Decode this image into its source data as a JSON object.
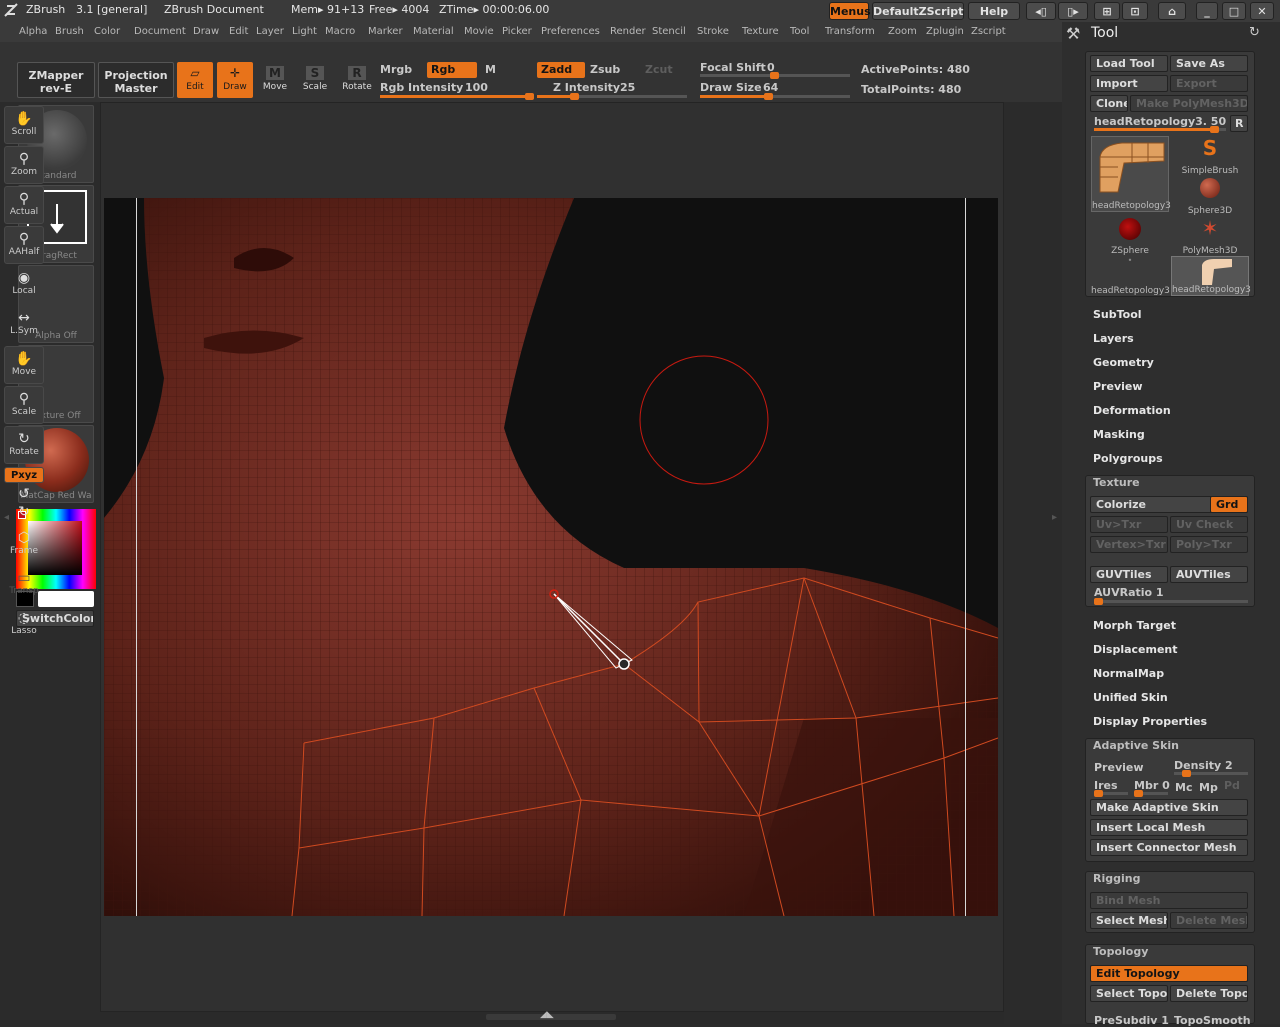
{
  "titlebar": {
    "app": "ZBrush",
    "version": "3.1 [general]",
    "document": "ZBrush Document",
    "mem": "Mem▸ 91+13",
    "free": "Free▸ 4004",
    "ztime": "ZTime▸ 00:00:06.00",
    "menus_btn": "Menus",
    "script_btn": "DefaultZScript",
    "help_btn": "Help"
  },
  "menubar": [
    "Alpha",
    "Brush",
    "Color",
    "Document",
    "Draw",
    "Edit",
    "Layer",
    "Light",
    "Macro",
    "Marker",
    "Material",
    "Movie",
    "Picker",
    "Preferences",
    "Render",
    "Stencil",
    "Stroke",
    "Texture",
    "Tool",
    "Transform",
    "Zoom",
    "Zplugin",
    "Zscript"
  ],
  "toolbar": {
    "zmapper_line1": "ZMapper",
    "zmapper_line2": "rev-E",
    "projection_line1": "Projection",
    "projection_line2": "Master",
    "modes": [
      {
        "label": "Edit",
        "icon": "edit-icon"
      },
      {
        "label": "Draw",
        "icon": "draw-icon"
      },
      {
        "label": "Move",
        "icon": "move-icon"
      },
      {
        "label": "Scale",
        "icon": "scale-icon"
      },
      {
        "label": "Rotate",
        "icon": "rotate-icon"
      }
    ],
    "mrgb": "Mrgb",
    "rgb": "Rgb",
    "m": "M",
    "rgb_intensity_label": "Rgb  Intensity",
    "rgb_intensity_value": "100",
    "rgb_intensity": 100,
    "zadd": "Zadd",
    "zsub": "Zsub",
    "zcut": "Zcut",
    "z_intensity_label": "Z  Intensity",
    "z_intensity_value": "25",
    "z_intensity": 25,
    "focal_label": "Focal  Shift",
    "focal_value": "0",
    "draw_size_label": "Draw  Size",
    "draw_size_value": "64",
    "draw_size": 64,
    "active_points": "ActivePoints: 480",
    "total_points": "TotalPoints: 480"
  },
  "leftshelf": {
    "brush": "Standard",
    "stroke": "DragRect",
    "alpha": "Alpha  Off",
    "texture": "Texture  Off",
    "material": "MatCap  Red  Wa",
    "switch_color": "SwitchColor"
  },
  "rightshelf": [
    "Scroll",
    "Zoom",
    "Actual",
    "AAHalf",
    "Local",
    "L.Sym",
    "Move",
    "Scale",
    "Rotate",
    "Frame",
    "Transp",
    "Lasso"
  ],
  "rightshelf_xyz": "Pxyz",
  "toolpanel": {
    "title": "Tool",
    "load_tool": "Load Tool",
    "save_as": "Save As",
    "import": "Import",
    "export": "Export",
    "clone": "Clone",
    "make_polymesh": "Make PolyMesh3D",
    "current_tool": "headRetopology3. 50",
    "r_btn": "R",
    "thumbs": [
      "headRetopology3",
      "SimpleBrush",
      "Sphere3D",
      "ZSphere",
      "PolyMesh3D",
      "headRetopology3",
      "headRetopology3"
    ],
    "sections": [
      "SubTool",
      "Layers",
      "Geometry",
      "Preview",
      "Deformation",
      "Masking",
      "Polygroups"
    ],
    "texture": {
      "title": "Texture",
      "colorize": "Colorize",
      "grd": "Grd",
      "uv_txr": "Uv>Txr",
      "uv_check": "Uv Check",
      "vertex_txr": "Vertex>Txr",
      "poly_txr": "Poly>Txr",
      "guvtiles": "GUVTiles",
      "auvtiles": "AUVTiles",
      "auvratio": "AUVRatio 1"
    },
    "sections2": [
      "Morph Target",
      "Displacement",
      "NormalMap",
      "Unified Skin",
      "Display Properties"
    ],
    "adaptive": {
      "title": "Adaptive Skin",
      "preview": "Preview",
      "density": "Density 2",
      "ires": "Ires",
      "mbr": "Mbr 0",
      "mc": "Mc",
      "mp": "Mp",
      "pd": "Pd",
      "make": "Make Adaptive Skin",
      "insert_local": "Insert Local Mesh",
      "insert_connector": "Insert Connector Mesh"
    },
    "rigging": {
      "title": "Rigging",
      "bind": "Bind Mesh",
      "select": "Select Mesh",
      "delete": "Delete Mesh"
    },
    "topology": {
      "title": "Topology",
      "edit": "Edit Topology",
      "select": "Select Topo",
      "delete": "Delete Topo",
      "presubdiv": "PreSubdiv 1",
      "toposmooth": "TopoSmooth"
    }
  },
  "colors": {
    "accent": "#e8731a",
    "panel": "#3a3a3a",
    "background": "#2b2b2b",
    "model": "#6b2a22"
  }
}
